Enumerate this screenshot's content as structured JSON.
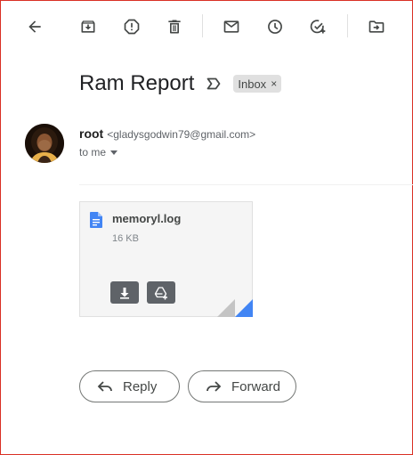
{
  "toolbar": {
    "icons": [
      "back-arrow-icon",
      "archive-icon",
      "report-spam-icon",
      "delete-icon",
      "mark-unread-icon",
      "snooze-icon",
      "add-to-tasks-icon",
      "move-to-icon"
    ]
  },
  "email": {
    "subject": "Ram Report",
    "label": "Inbox",
    "label_close": "×",
    "sender_name": "root",
    "sender_email": "<gladysgodwin79@gmail.com>",
    "recipient": "to me"
  },
  "attachment": {
    "filename": "memoryl.log",
    "size": "16 KB"
  },
  "actions": {
    "reply_label": "Reply",
    "forward_label": "Forward"
  },
  "colors": {
    "file_icon": "#4285f4",
    "frame_border": "#d93025",
    "chip_bg": "#e0e0e0"
  }
}
